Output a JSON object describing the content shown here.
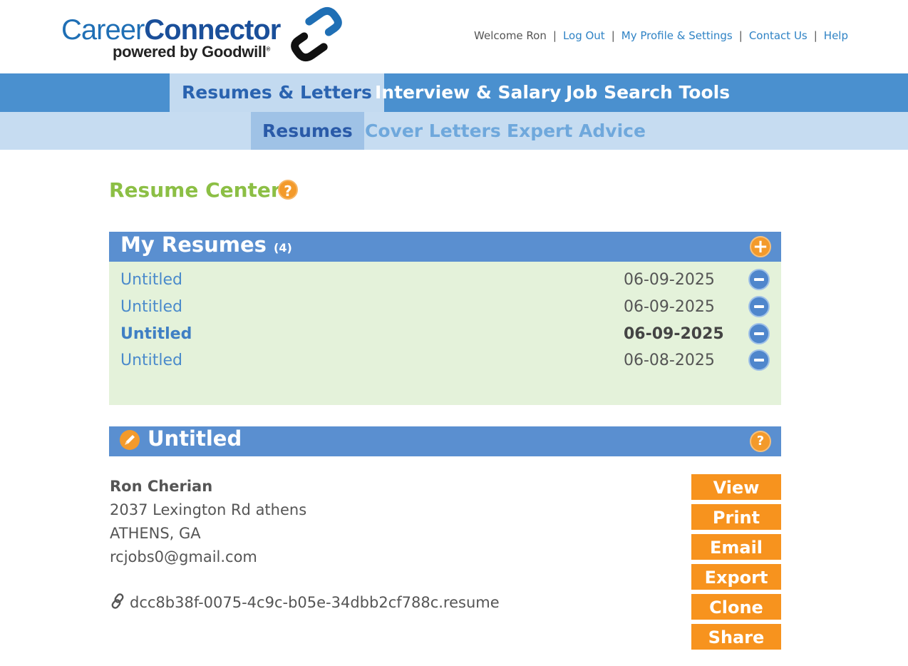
{
  "brand": {
    "career": "Career",
    "connector": "Connector",
    "powered": "powered by Goodwill",
    "reg": "®"
  },
  "header": {
    "welcome": "Welcome Ron",
    "links": {
      "logout": "Log Out",
      "profile": "My Profile & Settings",
      "contact": "Contact Us",
      "help": "Help"
    },
    "separator": "|"
  },
  "nav": {
    "primary": [
      "Resumes & Letters",
      "Interview & Salary",
      "Job Search Tools"
    ],
    "secondary": [
      "Resumes",
      "Cover Letters",
      "Expert Advice"
    ]
  },
  "page": {
    "title": "Resume Center",
    "help_glyph": "?"
  },
  "my_resumes": {
    "title": "My Resumes",
    "count": "(4)",
    "add_glyph": "+",
    "items": [
      {
        "name": "Untitled",
        "date": "06-09-2025"
      },
      {
        "name": "Untitled",
        "date": "06-09-2025"
      },
      {
        "name": "Untitled",
        "date": "06-09-2025",
        "selected": true
      },
      {
        "name": "Untitled",
        "date": "06-08-2025"
      }
    ]
  },
  "resume": {
    "title": "Untitled",
    "help_glyph": "?",
    "contact": {
      "name": "Ron Cherian",
      "address": "2037 Lexington Rd athens",
      "city": "ATHENS, GA",
      "email": "rcjobs0@gmail.com"
    },
    "file": "dcc8b38f-0075-4c9c-b05e-34dbb2cf788c.resume",
    "actions": {
      "view": "View",
      "print": "Print",
      "email": "Email",
      "export": "Export",
      "clone": "Clone",
      "share": "Share"
    }
  },
  "colors": {
    "nav_blue": "#4a90cf",
    "panel_blue": "#5a8fd0",
    "accent_orange": "#f7931e",
    "title_green": "#8cbf45",
    "list_bg": "#e4f2da"
  },
  "icons": {
    "logo": "chain-link-logo",
    "add": "plus-circle-icon",
    "remove": "minus-circle-icon",
    "edit": "pencil-icon",
    "help": "question-circle-icon",
    "file": "link-icon"
  }
}
